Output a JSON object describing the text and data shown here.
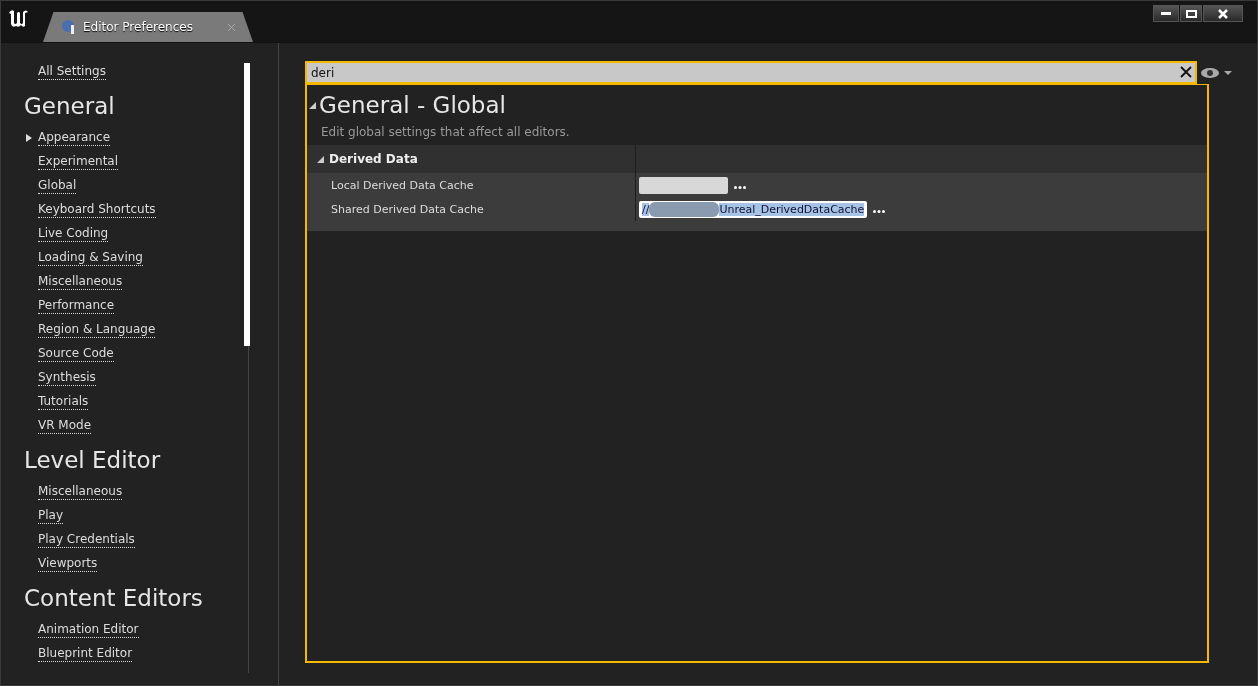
{
  "window": {
    "tab_title": "Editor Preferences"
  },
  "sidebar": {
    "all_settings": "All Settings",
    "sections": [
      {
        "title": "General",
        "items": [
          {
            "label": "Appearance",
            "kind": "group"
          },
          {
            "label": "Experimental",
            "kind": "link"
          },
          {
            "label": "Global",
            "kind": "link"
          },
          {
            "label": "Keyboard Shortcuts",
            "kind": "link"
          },
          {
            "label": "Live Coding",
            "kind": "link"
          },
          {
            "label": "Loading & Saving",
            "kind": "link"
          },
          {
            "label": "Miscellaneous",
            "kind": "link"
          },
          {
            "label": "Performance",
            "kind": "link"
          },
          {
            "label": "Region & Language",
            "kind": "link"
          },
          {
            "label": "Source Code",
            "kind": "link"
          },
          {
            "label": "Synthesis",
            "kind": "link"
          },
          {
            "label": "Tutorials",
            "kind": "link"
          },
          {
            "label": "VR Mode",
            "kind": "link"
          }
        ]
      },
      {
        "title": "Level Editor",
        "items": [
          {
            "label": "Miscellaneous",
            "kind": "link"
          },
          {
            "label": "Play",
            "kind": "link"
          },
          {
            "label": "Play Credentials",
            "kind": "link"
          },
          {
            "label": "Viewports",
            "kind": "link"
          }
        ]
      },
      {
        "title": "Content Editors",
        "items": [
          {
            "label": "Animation Editor",
            "kind": "link"
          },
          {
            "label": "Blueprint Editor",
            "kind": "link"
          }
        ]
      }
    ]
  },
  "search": {
    "value": "deri"
  },
  "details": {
    "title": "General - Global",
    "description": "Edit global settings that affect all editors.",
    "category": {
      "title": "Derived Data",
      "expanded": true,
      "rows": [
        {
          "label": "Local Derived Data Cache",
          "selected": false
        },
        {
          "label": "Shared Derived Data Cache",
          "value_prefix": "//",
          "value_suffix": "Unreal_DerivedDataCache",
          "redacted": true,
          "selected": true
        }
      ]
    }
  }
}
